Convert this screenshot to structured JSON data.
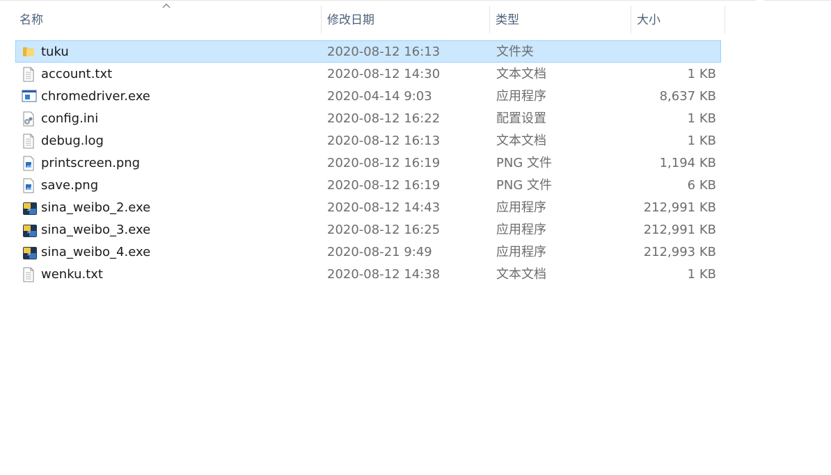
{
  "columns": {
    "name": "名称",
    "date": "修改日期",
    "type": "类型",
    "size": "大小"
  },
  "sort": {
    "column": "name",
    "direction": "ascending",
    "icon": "sort-up-chevron"
  },
  "colors": {
    "selection_bg": "#cce8ff",
    "selection_border": "#99d1ff",
    "header_text": "#4c607a",
    "detail_text": "#6d6d6d"
  },
  "files": [
    {
      "icon": "folder",
      "name": "tuku",
      "date": "2020-08-12 16:13",
      "type": "文件夹",
      "size": "",
      "selected": true
    },
    {
      "icon": "text-file",
      "name": "account.txt",
      "date": "2020-08-12 14:30",
      "type": "文本文档",
      "size": "1 KB",
      "selected": false
    },
    {
      "icon": "app-window",
      "name": "chromedriver.exe",
      "date": "2020-04-14 9:03",
      "type": "应用程序",
      "size": "8,637 KB",
      "selected": false
    },
    {
      "icon": "config-file",
      "name": "config.ini",
      "date": "2020-08-12 16:22",
      "type": "配置设置",
      "size": "1 KB",
      "selected": false
    },
    {
      "icon": "text-file",
      "name": "debug.log",
      "date": "2020-08-12 16:13",
      "type": "文本文档",
      "size": "1 KB",
      "selected": false
    },
    {
      "icon": "image-file",
      "name": "printscreen.png",
      "date": "2020-08-12 16:19",
      "type": "PNG 文件",
      "size": "1,194 KB",
      "selected": false
    },
    {
      "icon": "image-file",
      "name": "save.png",
      "date": "2020-08-12 16:19",
      "type": "PNG 文件",
      "size": "6 KB",
      "selected": false
    },
    {
      "icon": "python-exe",
      "name": "sina_weibo_2.exe",
      "date": "2020-08-12 14:43",
      "type": "应用程序",
      "size": "212,991 KB",
      "selected": false
    },
    {
      "icon": "python-exe",
      "name": "sina_weibo_3.exe",
      "date": "2020-08-12 16:25",
      "type": "应用程序",
      "size": "212,991 KB",
      "selected": false
    },
    {
      "icon": "python-exe",
      "name": "sina_weibo_4.exe",
      "date": "2020-08-21 9:49",
      "type": "应用程序",
      "size": "212,993 KB",
      "selected": false
    },
    {
      "icon": "text-file",
      "name": "wenku.txt",
      "date": "2020-08-12 14:38",
      "type": "文本文档",
      "size": "1 KB",
      "selected": false
    }
  ]
}
